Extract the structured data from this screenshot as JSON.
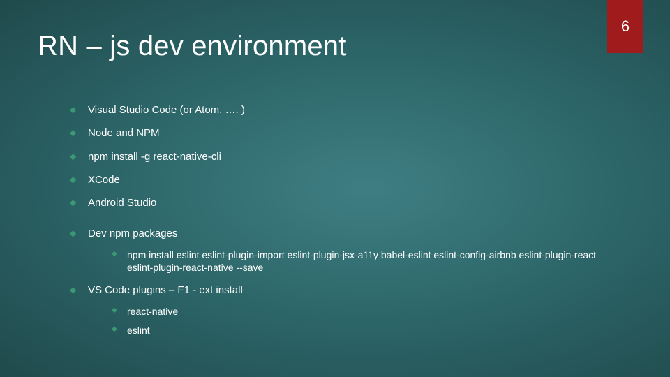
{
  "page_number": "6",
  "title": "RN – js dev environment",
  "bullets": {
    "b0": "Visual Studio Code (or Atom, …. )",
    "b1": "Node and NPM",
    "b2": "npm install -g react-native-cli",
    "b3": "XCode",
    "b4": "Android Studio",
    "b5": "Dev npm packages",
    "b5_sub0": "npm install eslint eslint-plugin-import eslint-plugin-jsx-a11y babel-eslint eslint-config-airbnb eslint-plugin-react eslint-plugin-react-native --save",
    "b6": "VS Code plugins – F1 - ext install",
    "b6_sub0": "react-native",
    "b6_sub1": "eslint"
  }
}
